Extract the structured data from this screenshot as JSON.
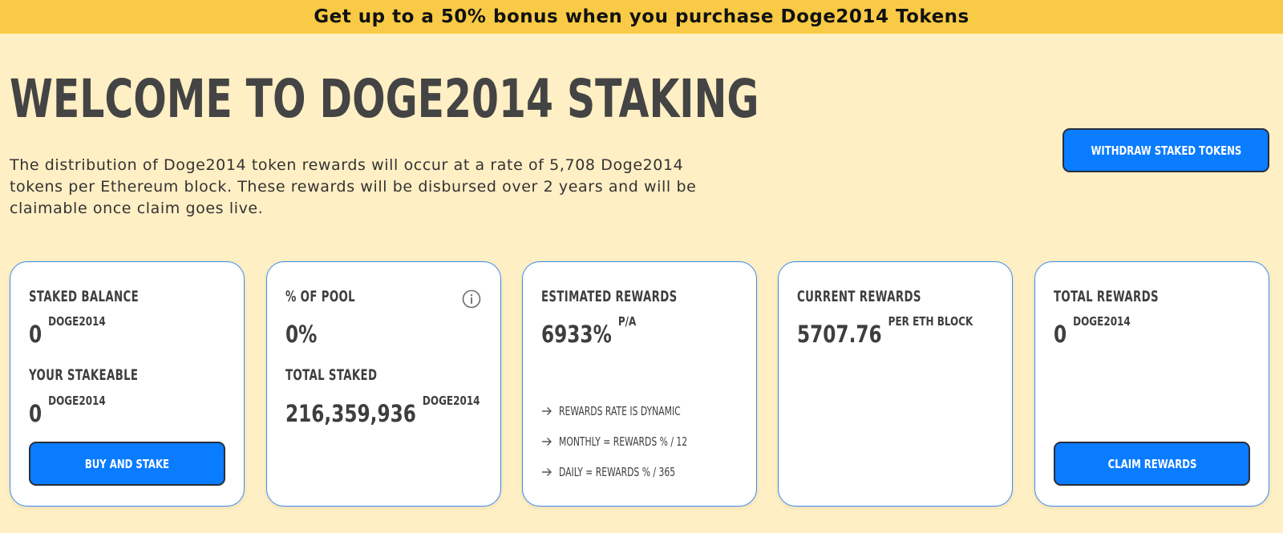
{
  "banner": {
    "text": "Get up to a 50% bonus when you purchase Doge2014 Tokens"
  },
  "header": {
    "title": "WELCOME TO DOGE2014 STAKING",
    "description": "The distribution of Doge2014 token rewards will occur at a rate of 5,708 Doge2014 tokens per Ethereum block. These rewards will be disbursed over 2 years and will be claimable once claim goes live.",
    "withdraw_label": "WITHDRAW STAKED TOKENS"
  },
  "cards": {
    "staked": {
      "label": "STAKED BALANCE",
      "value": "0",
      "unit": "DOGE2014",
      "stakeable_label": "YOUR STAKEABLE",
      "stakeable_value": "0",
      "stakeable_unit": "DOGE2014",
      "button_label": "BUY AND STAKE"
    },
    "pool": {
      "label": "% OF POOL",
      "value": "0%",
      "total_label": "TOTAL STAKED",
      "total_value": "216,359,936",
      "total_unit": "DOGE2014",
      "icon": "info-icon"
    },
    "estimated": {
      "label": "ESTIMATED REWARDS",
      "value": "6933%",
      "unit": "P/A",
      "bullets": [
        "REWARDS RATE IS DYNAMIC",
        "MONTHLY = REWARDS % / 12",
        "DAILY = REWARDS % / 365"
      ]
    },
    "current": {
      "label": "CURRENT REWARDS",
      "value": "5707.76",
      "unit": "PER ETH BLOCK"
    },
    "total": {
      "label": "TOTAL REWARDS",
      "value": "0",
      "unit": "DOGE2014",
      "button_label": "CLAIM REWARDS"
    }
  },
  "colors": {
    "banner": "#f8ca45",
    "background": "#ffefc4",
    "accent": "#0a7cff",
    "card_border": "#3b8cf0"
  }
}
